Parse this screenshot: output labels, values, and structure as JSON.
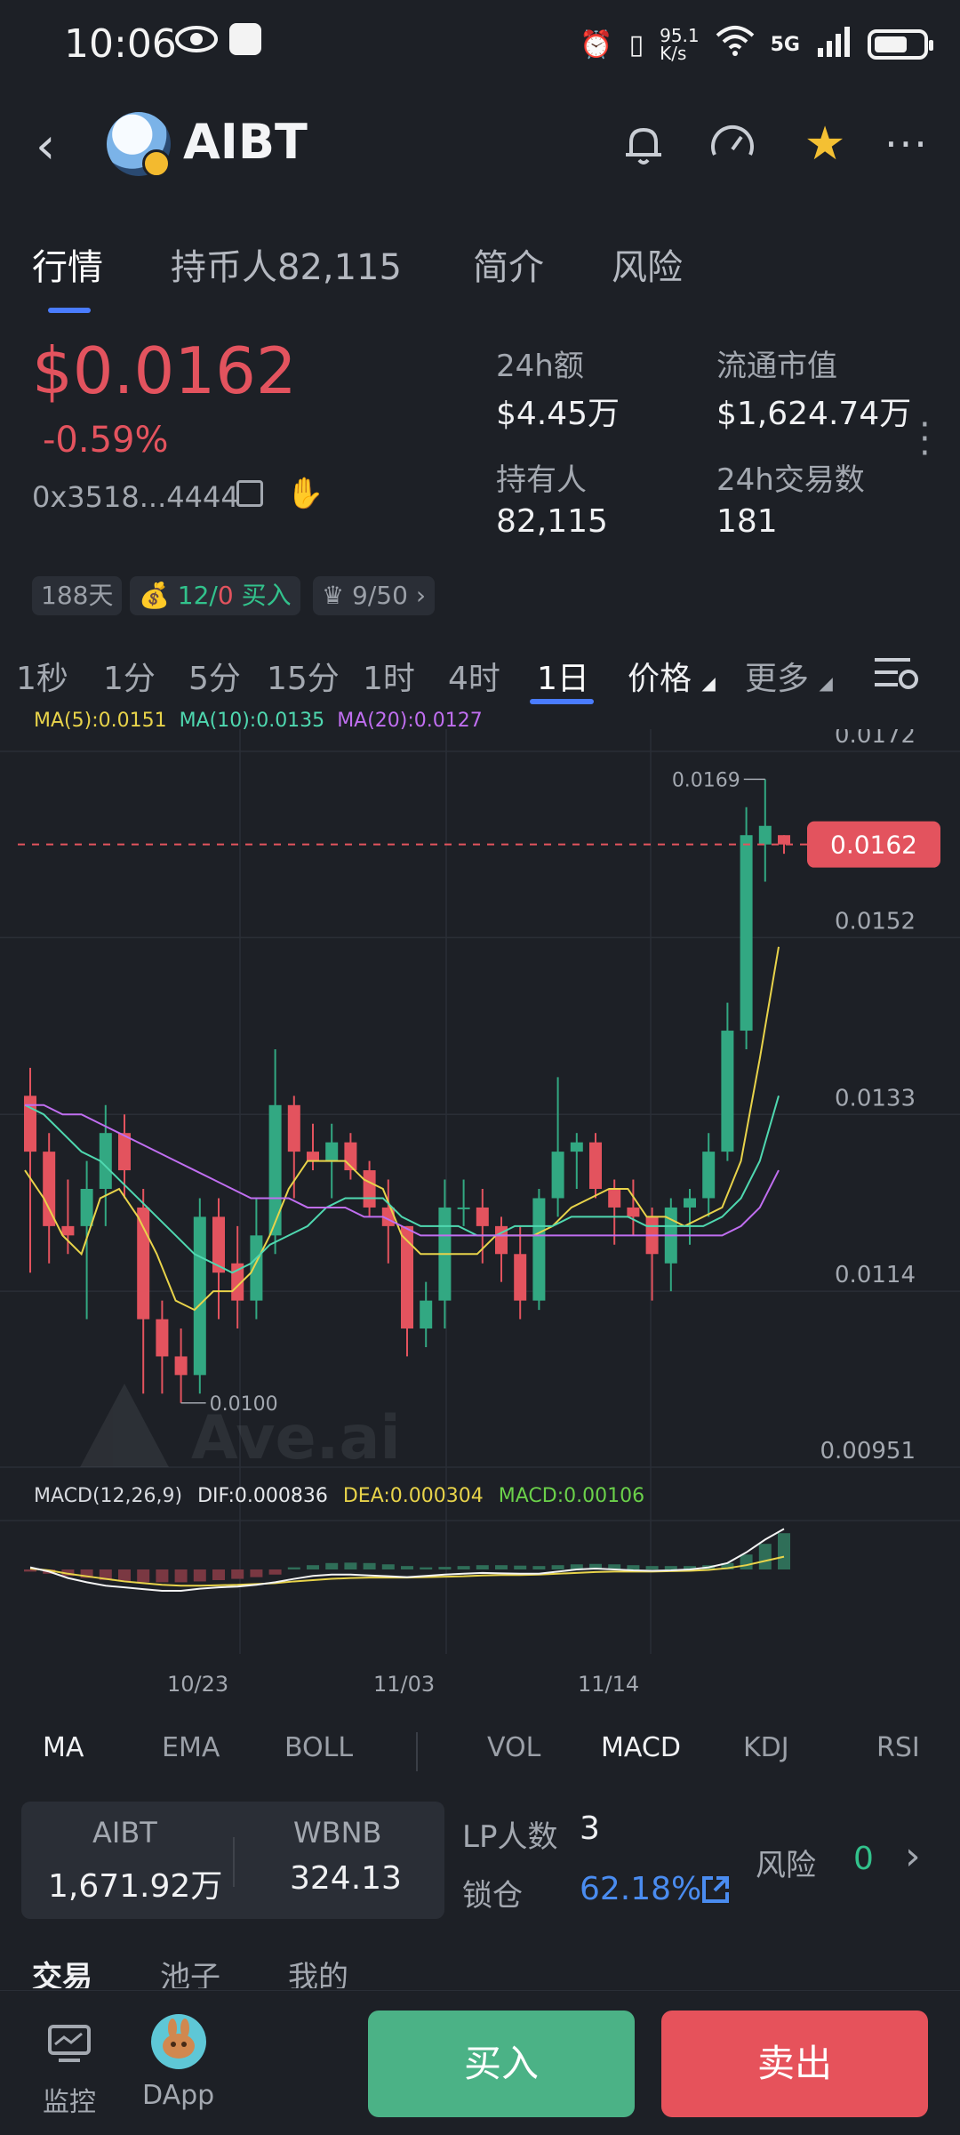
{
  "status_bar": {
    "time": "10:06",
    "net_speed": "95.1\nK/s",
    "network": "5G"
  },
  "header": {
    "title": "AIBT",
    "icons": [
      "back-icon",
      "bell-icon",
      "speedometer-icon",
      "star-icon",
      "more-icon"
    ]
  },
  "tabs": [
    {
      "label": "行情"
    },
    {
      "label": "持币人82,115"
    },
    {
      "label": "简介"
    },
    {
      "label": "风险"
    }
  ],
  "price": {
    "value": "$0.0162",
    "change": "-0.59%",
    "address": "0x3518...4444"
  },
  "stats": {
    "volume_label": "24h额",
    "volume_value": "$4.45万",
    "mcap_label": "流通市值",
    "mcap_value": "$1,624.74万",
    "holders_label": "持有人",
    "holders_value": "82,115",
    "tx_label": "24h交易数",
    "tx_value": "181"
  },
  "tags": {
    "days": "188天",
    "buy_count": "12/",
    "sell_count": "0",
    "buy_label": "买入",
    "rank": "9/50"
  },
  "intervals": [
    "1秒",
    "1分",
    "5分",
    "15分",
    "1时",
    "4时",
    "1日",
    "价格",
    "更多"
  ],
  "chart_data": {
    "type": "candlestick",
    "ma_legend": {
      "ma5": "MA(5):0.0151",
      "ma10": "MA(10):0.0135",
      "ma20": "MA(20):0.0127"
    },
    "y_ticks": [
      "0.0172",
      "0.0152",
      "0.0133",
      "0.0114",
      "0.00951"
    ],
    "ylim": [
      0.00951,
      0.0172
    ],
    "current_price": "0.0162",
    "high_label": "0.0169",
    "low_label": "0.0100",
    "x_ticks": [
      "10/23",
      "11/03",
      "11/14"
    ],
    "candles": [
      {
        "o": 0.0135,
        "h": 0.0138,
        "l": 0.0116,
        "c": 0.0129
      },
      {
        "o": 0.0129,
        "h": 0.0131,
        "l": 0.0117,
        "c": 0.0121
      },
      {
        "o": 0.0121,
        "h": 0.0126,
        "l": 0.0118,
        "c": 0.012
      },
      {
        "o": 0.0121,
        "h": 0.0128,
        "l": 0.0111,
        "c": 0.0125
      },
      {
        "o": 0.0125,
        "h": 0.0134,
        "l": 0.0121,
        "c": 0.0131
      },
      {
        "o": 0.0131,
        "h": 0.0133,
        "l": 0.0124,
        "c": 0.0127
      },
      {
        "o": 0.0123,
        "h": 0.0125,
        "l": 0.0103,
        "c": 0.0111
      },
      {
        "o": 0.0111,
        "h": 0.0113,
        "l": 0.0103,
        "c": 0.0107
      },
      {
        "o": 0.0107,
        "h": 0.011,
        "l": 0.0102,
        "c": 0.0105
      },
      {
        "o": 0.0105,
        "h": 0.0124,
        "l": 0.0103,
        "c": 0.0122
      },
      {
        "o": 0.0122,
        "h": 0.0124,
        "l": 0.0111,
        "c": 0.0116
      },
      {
        "o": 0.0117,
        "h": 0.0121,
        "l": 0.011,
        "c": 0.0113
      },
      {
        "o": 0.0113,
        "h": 0.0124,
        "l": 0.0111,
        "c": 0.012
      },
      {
        "o": 0.012,
        "h": 0.014,
        "l": 0.0118,
        "c": 0.0134
      },
      {
        "o": 0.0134,
        "h": 0.0135,
        "l": 0.0124,
        "c": 0.0129
      },
      {
        "o": 0.0129,
        "h": 0.0132,
        "l": 0.0127,
        "c": 0.0128
      },
      {
        "o": 0.0128,
        "h": 0.0132,
        "l": 0.0124,
        "c": 0.013
      },
      {
        "o": 0.013,
        "h": 0.0131,
        "l": 0.0126,
        "c": 0.0127
      },
      {
        "o": 0.0127,
        "h": 0.0128,
        "l": 0.0122,
        "c": 0.0123
      },
      {
        "o": 0.0123,
        "h": 0.0126,
        "l": 0.0117,
        "c": 0.0121
      },
      {
        "o": 0.0121,
        "h": 0.0121,
        "l": 0.0107,
        "c": 0.011
      },
      {
        "o": 0.011,
        "h": 0.0115,
        "l": 0.0108,
        "c": 0.0113
      },
      {
        "o": 0.0113,
        "h": 0.0126,
        "l": 0.011,
        "c": 0.0123
      },
      {
        "o": 0.0123,
        "h": 0.0126,
        "l": 0.0121,
        "c": 0.0123
      },
      {
        "o": 0.0123,
        "h": 0.0125,
        "l": 0.0117,
        "c": 0.0121
      },
      {
        "o": 0.0121,
        "h": 0.0122,
        "l": 0.0115,
        "c": 0.0118
      },
      {
        "o": 0.0118,
        "h": 0.0121,
        "l": 0.0111,
        "c": 0.0113
      },
      {
        "o": 0.0113,
        "h": 0.0125,
        "l": 0.0112,
        "c": 0.0124
      },
      {
        "o": 0.0124,
        "h": 0.0137,
        "l": 0.0122,
        "c": 0.0129
      },
      {
        "o": 0.0129,
        "h": 0.0131,
        "l": 0.0125,
        "c": 0.013
      },
      {
        "o": 0.013,
        "h": 0.0131,
        "l": 0.0124,
        "c": 0.0125
      },
      {
        "o": 0.0125,
        "h": 0.0126,
        "l": 0.0119,
        "c": 0.0123
      },
      {
        "o": 0.0123,
        "h": 0.0126,
        "l": 0.012,
        "c": 0.0122
      },
      {
        "o": 0.0122,
        "h": 0.0123,
        "l": 0.0113,
        "c": 0.0118
      },
      {
        "o": 0.0117,
        "h": 0.0124,
        "l": 0.0114,
        "c": 0.0123
      },
      {
        "o": 0.0123,
        "h": 0.0125,
        "l": 0.0119,
        "c": 0.0124
      },
      {
        "o": 0.0124,
        "h": 0.0131,
        "l": 0.0122,
        "c": 0.0129
      },
      {
        "o": 0.0129,
        "h": 0.0145,
        "l": 0.0128,
        "c": 0.0142
      },
      {
        "o": 0.0142,
        "h": 0.0166,
        "l": 0.014,
        "c": 0.0163
      },
      {
        "o": 0.0162,
        "h": 0.0169,
        "l": 0.0158,
        "c": 0.0164
      },
      {
        "o": 0.0163,
        "h": 0.0163,
        "l": 0.0161,
        "c": 0.0162
      }
    ],
    "ma5": [
      0.0127,
      0.0124,
      0.012,
      0.0118,
      0.0124,
      0.0125,
      0.0122,
      0.0118,
      0.0113,
      0.0112,
      0.0114,
      0.0114,
      0.0116,
      0.012,
      0.0125,
      0.0128,
      0.0128,
      0.0128,
      0.0126,
      0.0125,
      0.012,
      0.0118,
      0.0118,
      0.0118,
      0.0118,
      0.012,
      0.012,
      0.012,
      0.0121,
      0.0123,
      0.0124,
      0.0125,
      0.0125,
      0.0122,
      0.0122,
      0.0121,
      0.0122,
      0.0123,
      0.0128,
      0.0139,
      0.0151
    ],
    "ma10": [
      0.0134,
      0.0133,
      0.0131,
      0.0129,
      0.0128,
      0.0126,
      0.0124,
      0.0122,
      0.012,
      0.0118,
      0.0117,
      0.0116,
      0.0117,
      0.0119,
      0.012,
      0.0121,
      0.0123,
      0.0124,
      0.0124,
      0.0124,
      0.0122,
      0.0121,
      0.0121,
      0.0121,
      0.012,
      0.012,
      0.0121,
      0.0121,
      0.0121,
      0.0122,
      0.0122,
      0.0122,
      0.0122,
      0.0121,
      0.0121,
      0.0121,
      0.0121,
      0.0122,
      0.0124,
      0.0128,
      0.0135
    ],
    "ma20": [
      0.0134,
      0.0134,
      0.0133,
      0.0133,
      0.0132,
      0.0131,
      0.013,
      0.0129,
      0.0128,
      0.0127,
      0.0126,
      0.0125,
      0.0124,
      0.0124,
      0.0124,
      0.0123,
      0.0123,
      0.0123,
      0.0122,
      0.0122,
      0.0121,
      0.012,
      0.012,
      0.012,
      0.012,
      0.012,
      0.012,
      0.012,
      0.012,
      0.012,
      0.012,
      0.012,
      0.012,
      0.012,
      0.012,
      0.012,
      0.012,
      0.012,
      0.0121,
      0.0123,
      0.0127
    ]
  },
  "macd": {
    "title": "MACD(12,26,9)",
    "dif": "DIF:0.000836",
    "dea": "DEA:0.000304",
    "macd": "MACD:0.00106",
    "hist": [
      -0.05,
      -0.1,
      -0.15,
      -0.2,
      -0.25,
      -0.28,
      -0.3,
      -0.3,
      -0.3,
      -0.28,
      -0.25,
      -0.22,
      -0.18,
      -0.12,
      0.05,
      0.1,
      0.15,
      0.16,
      0.15,
      0.12,
      0.08,
      0.05,
      0.06,
      0.08,
      0.1,
      0.1,
      0.09,
      0.08,
      0.1,
      0.12,
      0.13,
      0.12,
      0.1,
      0.08,
      0.08,
      0.08,
      0.1,
      0.15,
      0.35,
      0.6,
      0.85
    ],
    "dif_line": [
      0.05,
      -0.05,
      -0.2,
      -0.3,
      -0.38,
      -0.42,
      -0.46,
      -0.5,
      -0.5,
      -0.45,
      -0.42,
      -0.4,
      -0.36,
      -0.3,
      -0.22,
      -0.15,
      -0.12,
      -0.12,
      -0.14,
      -0.16,
      -0.18,
      -0.15,
      -0.12,
      -0.1,
      -0.08,
      -0.09,
      -0.1,
      -0.1,
      -0.05,
      0.0,
      0.02,
      0.0,
      -0.02,
      -0.03,
      -0.02,
      0.0,
      0.05,
      0.15,
      0.4,
      0.7,
      0.95
    ],
    "dea_line": [
      0.02,
      -0.02,
      -0.1,
      -0.16,
      -0.22,
      -0.28,
      -0.32,
      -0.36,
      -0.38,
      -0.38,
      -0.37,
      -0.36,
      -0.34,
      -0.32,
      -0.28,
      -0.25,
      -0.22,
      -0.2,
      -0.19,
      -0.19,
      -0.19,
      -0.18,
      -0.17,
      -0.16,
      -0.14,
      -0.13,
      -0.13,
      -0.12,
      -0.1,
      -0.08,
      -0.06,
      -0.05,
      -0.05,
      -0.05,
      -0.04,
      -0.03,
      -0.01,
      0.03,
      0.1,
      0.2,
      0.3
    ]
  },
  "indicators": [
    "MA",
    "EMA",
    "BOLL",
    "VOL",
    "MACD",
    "KDJ",
    "RSI"
  ],
  "pool": {
    "token_a": "AIBT",
    "token_a_amount": "1,671.92万",
    "token_b": "WBNB",
    "token_b_amount": "324.13",
    "lp_label": "LP人数",
    "lp_value": "3",
    "lock_label": "锁仓",
    "lock_value": "62.18%",
    "risk_label": "风险",
    "risk_value": "0"
  },
  "subtabs": [
    "交易",
    "池子",
    "我的"
  ],
  "bottom_nav": {
    "monitor": "监控",
    "dapp": "DApp",
    "buy": "买入",
    "sell": "卖出"
  },
  "colors": {
    "up": "#32a882",
    "down": "#e3535e",
    "accent": "#4a7cff",
    "ma5": "#e8d34a",
    "ma10": "#4fd8b0",
    "ma20": "#c06ef0"
  }
}
